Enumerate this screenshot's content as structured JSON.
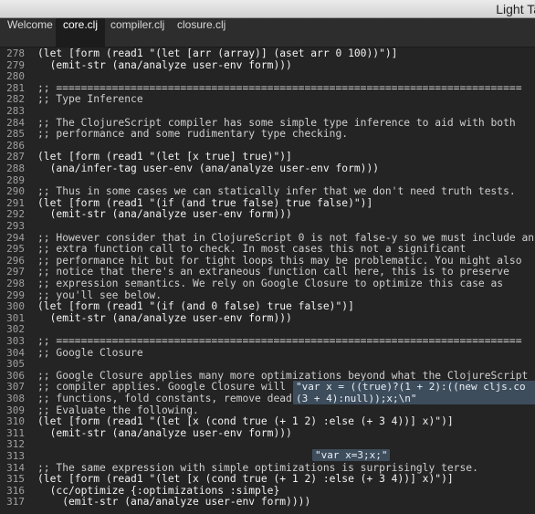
{
  "window": {
    "title": "Light Ta"
  },
  "tabs": [
    {
      "label": "Welcome",
      "active": false
    },
    {
      "label": "core.clj",
      "active": true
    },
    {
      "label": "compiler.clj",
      "active": false
    },
    {
      "label": "closure.clj",
      "active": false
    }
  ],
  "editor": {
    "lines": [
      {
        "n": "278",
        "text": "(let [form (read1 \"(let [arr (array)] (aset arr 0 100))\")]",
        "comment": false
      },
      {
        "n": "279",
        "text": "  (emit-str (ana/analyze user-env form)))",
        "comment": false
      },
      {
        "n": "280",
        "text": "",
        "comment": false
      },
      {
        "n": "281",
        "text": ";; ===========================================================================",
        "comment": true
      },
      {
        "n": "282",
        "text": ";; Type Inference",
        "comment": true
      },
      {
        "n": "283",
        "text": "",
        "comment": false
      },
      {
        "n": "284",
        "text": ";; The ClojureScript compiler has some simple type inference to aid with both",
        "comment": true
      },
      {
        "n": "285",
        "text": ";; performance and some rudimentary type checking.",
        "comment": true
      },
      {
        "n": "286",
        "text": "",
        "comment": false
      },
      {
        "n": "287",
        "text": "(let [form (read1 \"(let [x true] true)\")]",
        "comment": false
      },
      {
        "n": "288",
        "text": "  (ana/infer-tag user-env (ana/analyze user-env form)))",
        "comment": false
      },
      {
        "n": "289",
        "text": "",
        "comment": false
      },
      {
        "n": "290",
        "text": ";; Thus in some cases we can statically infer that we don't need truth tests.",
        "comment": true
      },
      {
        "n": "291",
        "text": "(let [form (read1 \"(if (and true false) true false)\")]",
        "comment": false
      },
      {
        "n": "292",
        "text": "  (emit-str (ana/analyze user-env form)))",
        "comment": false
      },
      {
        "n": "293",
        "text": "",
        "comment": false
      },
      {
        "n": "294",
        "text": ";; However consider that in ClojureScript 0 is not false-y so we must include an",
        "comment": true
      },
      {
        "n": "295",
        "text": ";; extra function call to check. In most cases this not a significant",
        "comment": true
      },
      {
        "n": "296",
        "text": ";; performance hit but for tight loops this may be problematic. You might also",
        "comment": true
      },
      {
        "n": "297",
        "text": ";; notice that there's an extraneous function call here, this is to preserve",
        "comment": true
      },
      {
        "n": "298",
        "text": ";; expression semantics. We rely on Google Closure to optimize this case as",
        "comment": true
      },
      {
        "n": "299",
        "text": ";; you'll see below.",
        "comment": true
      },
      {
        "n": "300",
        "text": "(let [form (read1 \"(if (and 0 false) true false)\")]",
        "comment": false
      },
      {
        "n": "301",
        "text": "  (emit-str (ana/analyze user-env form)))",
        "comment": false
      },
      {
        "n": "302",
        "text": "",
        "comment": false
      },
      {
        "n": "303",
        "text": ";; ===========================================================================",
        "comment": true
      },
      {
        "n": "304",
        "text": ";; Google Closure",
        "comment": true
      },
      {
        "n": "305",
        "text": "",
        "comment": false
      },
      {
        "n": "306",
        "text": ";; Google Closure applies many more optimizations beyond what the ClojureScript",
        "comment": true
      },
      {
        "n": "307",
        "text": ";; compiler applies. Google Closure will remove superfluous functions, inline",
        "comment": true
      },
      {
        "n": "308",
        "text": ";; functions, fold constants, remove dead code, and minify the final source.",
        "comment": true
      },
      {
        "n": "309",
        "text": ";; Evaluate the following.",
        "comment": true
      },
      {
        "n": "310",
        "text": "(let [form (read1 \"(let [x (cond true (+ 1 2) :else (+ 3 4))] x)\")]",
        "comment": false
      },
      {
        "n": "311",
        "text": "  (emit-str (ana/analyze user-env form)))",
        "comment": false
      },
      {
        "n": "312",
        "text": "",
        "comment": false
      },
      {
        "n": "313",
        "text": "",
        "comment": false
      },
      {
        "n": "314",
        "text": ";; The same expression with simple optimizations is surprisingly terse.",
        "comment": true
      },
      {
        "n": "315",
        "text": "(let [form (read1 \"(let [x (cond true (+ 1 2) :else (+ 3 4))] x)\")]",
        "comment": false
      },
      {
        "n": "316",
        "text": "  (cc/optimize {:optimizations :simple}",
        "comment": false
      },
      {
        "n": "317",
        "text": "    (emit-str (ana/analyze user-env form))))",
        "comment": false
      }
    ],
    "results": {
      "line311": "\"var x = ((true)?(1 + 2):((new cljs.co\n(3 + 4):null));x;\\n\"",
      "line316": "\"var x=3;x;\""
    }
  }
}
